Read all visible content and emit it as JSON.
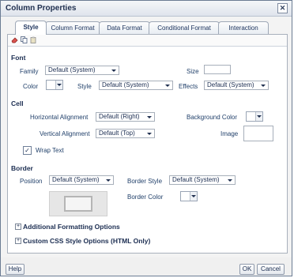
{
  "dialog": {
    "title": "Column Properties"
  },
  "tabs": [
    "Style",
    "Column Format",
    "Data Format",
    "Conditional Format",
    "Interaction"
  ],
  "font": {
    "section_title": "Font",
    "family_label": "Family",
    "family_value": "Default (System)",
    "size_label": "Size",
    "size_value": "",
    "color_label": "Color",
    "style_label": "Style",
    "style_value": "Default (System)",
    "effects_label": "Effects",
    "effects_value": "Default (System)"
  },
  "cell": {
    "section_title": "Cell",
    "h_align_label": "Horizontal Alignment",
    "h_align_value": "Default (Right)",
    "bg_color_label": "Background Color",
    "v_align_label": "Vertical Alignment",
    "v_align_value": "Default (Top)",
    "image_label": "Image",
    "wrap_text_label": "Wrap Text",
    "wrap_text_checked": true
  },
  "border": {
    "section_title": "Border",
    "position_label": "Position",
    "position_value": "Default (System)",
    "style_label": "Border Style",
    "style_value": "Default (System)",
    "color_label": "Border Color"
  },
  "expanders": [
    "Additional Formatting Options",
    "Custom CSS Style Options (HTML Only)"
  ],
  "buttons": {
    "help": "Help",
    "ok": "OK",
    "cancel": "Cancel"
  },
  "colors": {
    "check_mark": "✓",
    "toolbar_icons": [
      "eraser-icon",
      "copy-icon",
      "paste-icon"
    ]
  }
}
